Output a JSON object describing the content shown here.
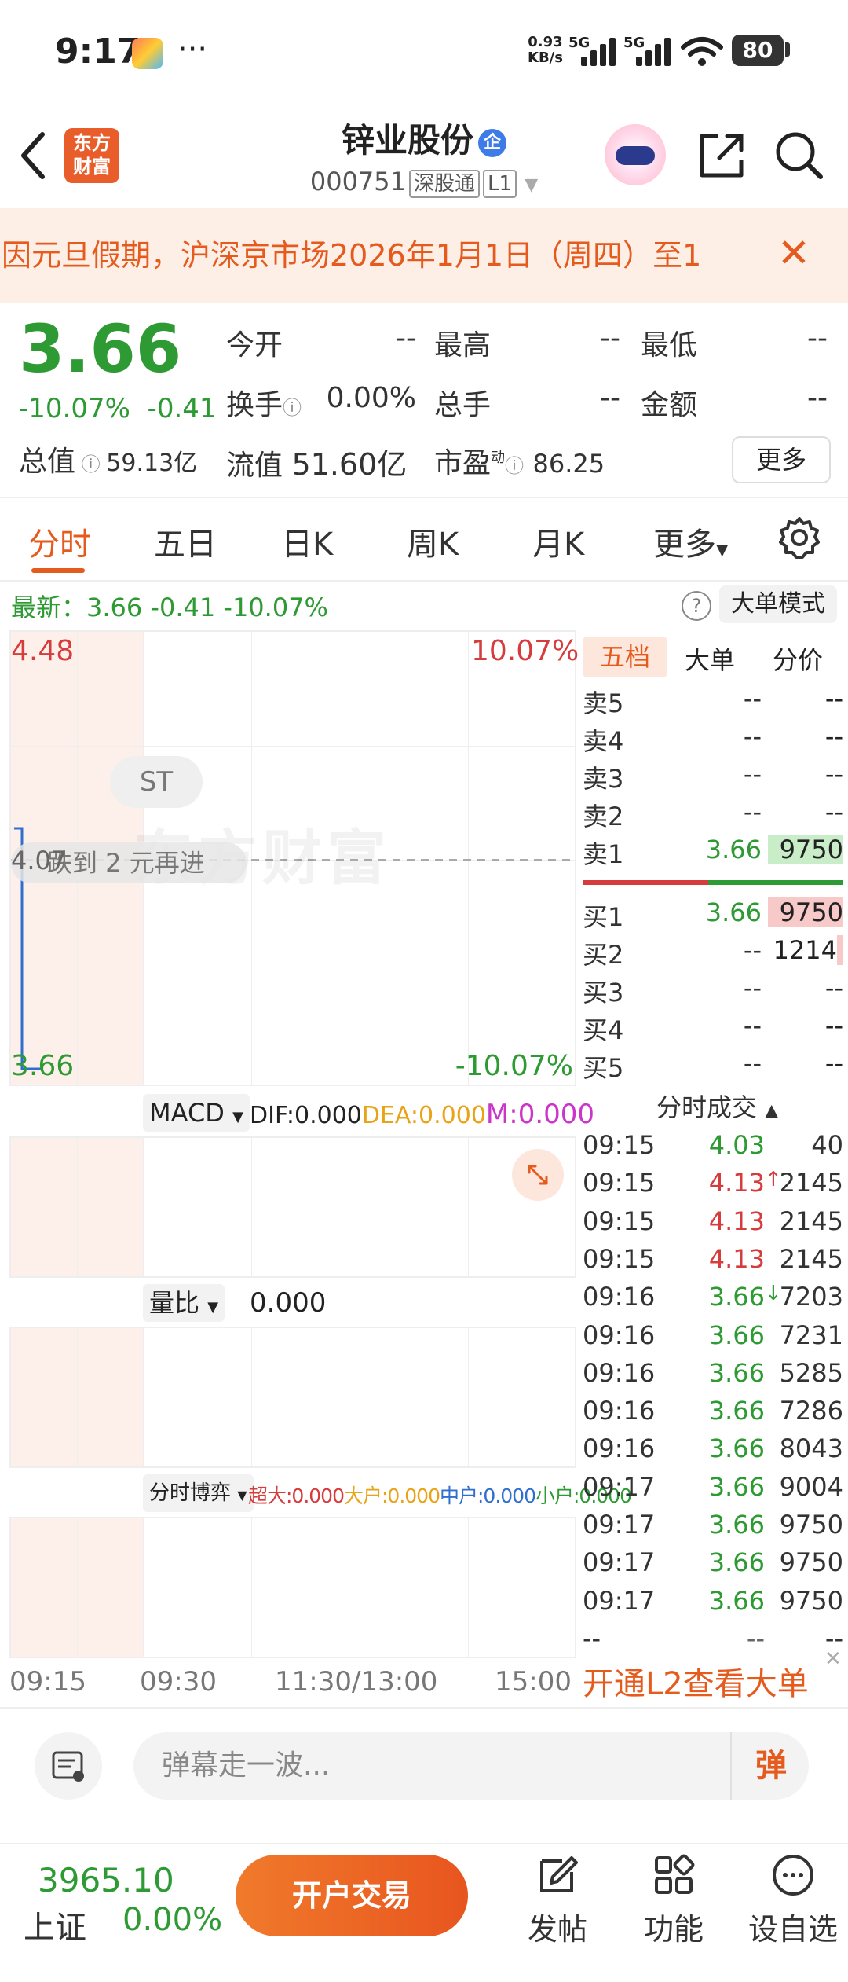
{
  "status_bar": {
    "time": "9:17",
    "dots": "···",
    "speed_value": "0.93",
    "speed_unit": "KB/s",
    "net1": "5G",
    "net2": "5G",
    "battery": "80"
  },
  "header": {
    "logo_top": "东方",
    "logo_bottom": "财富",
    "title": "锌业股份",
    "title_badge": "企",
    "code": "000751",
    "tag_connect": "深股通",
    "tag_level": "L1"
  },
  "notice": {
    "text": "因元旦假期，沪深京市场2026年1月1日（周四）至1"
  },
  "quote": {
    "price": "3.66",
    "change_pct": "-10.07%",
    "change_amt": "-0.41",
    "total_mv_label": "总值",
    "total_mv": "59.13亿",
    "open_label": "今开",
    "open": "--",
    "high_label": "最高",
    "high": "--",
    "low_label": "最低",
    "low": "--",
    "turnover_label": "换手",
    "turnover": "0.00%",
    "volume_label": "总手",
    "volume": "--",
    "amount_label": "金额",
    "amount": "--",
    "float_mv_label": "流值",
    "float_mv": "51.60亿",
    "pe_label": "市盈",
    "pe_sup": "动",
    "pe": "86.25",
    "more": "更多"
  },
  "tabs": {
    "items": [
      "分时",
      "五日",
      "日K",
      "周K",
      "月K",
      "更多"
    ]
  },
  "latest": {
    "text": "最新：3.66  -0.41  -10.07%",
    "mode_button": "大单模式",
    "help": "?"
  },
  "chart": {
    "top_price": "4.48",
    "top_pct": "10.07%",
    "bottom_price": "3.66",
    "bottom_pct": "-10.07%",
    "mid_label": "4.07",
    "watermark": "东方财富",
    "st_pill": "ST",
    "tooltip": "跌到 2 元再进"
  },
  "indicators": {
    "macd_name": "MACD",
    "dif": "DIF:0.000",
    "dea": "DEA:0.000",
    "m": "M:0.000",
    "vr_name": "量比",
    "vr": "0.000",
    "game_name": "分时博弈",
    "super": "超大:0.000",
    "big": "大户:0.000",
    "mid": "中户:0.000",
    "small": "小户:0.000",
    "colors": {
      "dea": "#e8a317",
      "m": "#c936c9",
      "super": "#d63c3c",
      "big": "#e8a317",
      "mid": "#2f6fcf",
      "small": "#2e9a33"
    }
  },
  "orderbook": {
    "tabs": [
      "五档",
      "大单",
      "分价"
    ],
    "asks": [
      {
        "label": "卖5",
        "price": "--",
        "vol": "--"
      },
      {
        "label": "卖4",
        "price": "--",
        "vol": "--"
      },
      {
        "label": "卖3",
        "price": "--",
        "vol": "--"
      },
      {
        "label": "卖2",
        "price": "--",
        "vol": "--"
      },
      {
        "label": "卖1",
        "price": "3.66",
        "vol": "9750"
      }
    ],
    "bids": [
      {
        "label": "买1",
        "price": "3.66",
        "vol": "9750"
      },
      {
        "label": "买2",
        "price": "--",
        "vol": "1214"
      },
      {
        "label": "买3",
        "price": "--",
        "vol": "--"
      },
      {
        "label": "买4",
        "price": "--",
        "vol": "--"
      },
      {
        "label": "买5",
        "price": "--",
        "vol": "--"
      }
    ]
  },
  "ticks": {
    "title": "分时成交",
    "rows": [
      {
        "time": "09:15",
        "price": "4.03",
        "vol": "40",
        "color": "green",
        "arrow": ""
      },
      {
        "time": "09:15",
        "price": "4.13",
        "vol": "2145",
        "color": "red",
        "arrow": "↑"
      },
      {
        "time": "09:15",
        "price": "4.13",
        "vol": "2145",
        "color": "red",
        "arrow": ""
      },
      {
        "time": "09:15",
        "price": "4.13",
        "vol": "2145",
        "color": "red",
        "arrow": ""
      },
      {
        "time": "09:16",
        "price": "3.66",
        "vol": "7203",
        "color": "green",
        "arrow": "↓"
      },
      {
        "time": "09:16",
        "price": "3.66",
        "vol": "7231",
        "color": "green",
        "arrow": ""
      },
      {
        "time": "09:16",
        "price": "3.66",
        "vol": "5285",
        "color": "green",
        "arrow": ""
      },
      {
        "time": "09:16",
        "price": "3.66",
        "vol": "7286",
        "color": "green",
        "arrow": ""
      },
      {
        "time": "09:16",
        "price": "3.66",
        "vol": "8043",
        "color": "green",
        "arrow": ""
      },
      {
        "time": "09:17",
        "price": "3.66",
        "vol": "9004",
        "color": "green",
        "arrow": ""
      },
      {
        "time": "09:17",
        "price": "3.66",
        "vol": "9750",
        "color": "green",
        "arrow": ""
      },
      {
        "time": "09:17",
        "price": "3.66",
        "vol": "9750",
        "color": "green",
        "arrow": ""
      },
      {
        "time": "09:17",
        "price": "3.66",
        "vol": "9750",
        "color": "green",
        "arrow": ""
      },
      {
        "time": "--",
        "price": "--",
        "vol": "--",
        "color": "gray",
        "arrow": ""
      }
    ]
  },
  "time_axis": [
    "09:15",
    "09:30",
    "11:30/13:00",
    "15:00"
  ],
  "l2_promo": "开通L2查看大单",
  "danmu": {
    "placeholder": "弹幕走一波...",
    "button": "弹"
  },
  "bottom": {
    "index_value": "3965.10",
    "index_name": "上证",
    "index_change": "0.00%",
    "trade_button": "开户交易",
    "nav": [
      "发帖",
      "功能",
      "设自选"
    ]
  },
  "colors": {
    "accent": "#e55a1d",
    "up": "#d63c3c",
    "down": "#2e9a33"
  }
}
